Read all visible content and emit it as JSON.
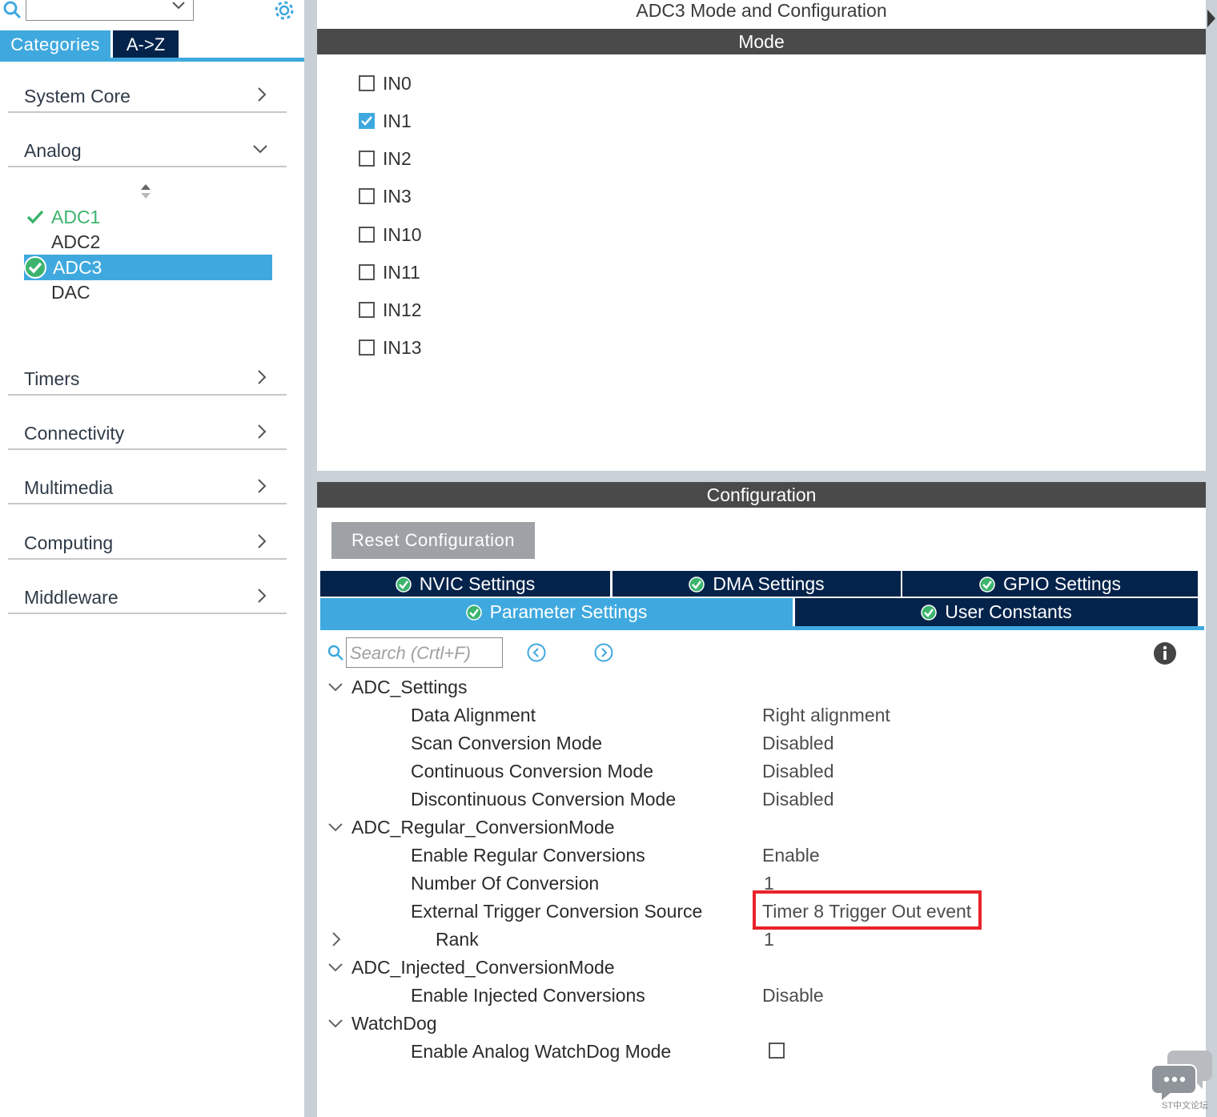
{
  "left_panel": {
    "tabs": {
      "categories": "Categories",
      "az": "A->Z"
    },
    "categories": [
      {
        "label": "System Core",
        "expanded": false
      },
      {
        "label": "Analog",
        "expanded": true
      },
      {
        "label": "Timers",
        "expanded": false
      },
      {
        "label": "Connectivity",
        "expanded": false
      },
      {
        "label": "Multimedia",
        "expanded": false
      },
      {
        "label": "Computing",
        "expanded": false
      },
      {
        "label": "Middleware",
        "expanded": false
      }
    ],
    "analog_items": [
      {
        "label": "ADC1",
        "status": "configured"
      },
      {
        "label": "ADC2",
        "status": "none"
      },
      {
        "label": "ADC3",
        "status": "selected"
      },
      {
        "label": "DAC",
        "status": "none"
      }
    ]
  },
  "main": {
    "title": "ADC3 Mode and Configuration",
    "mode_header": "Mode",
    "channels": [
      {
        "label": "IN0",
        "checked": false
      },
      {
        "label": "IN1",
        "checked": true
      },
      {
        "label": "IN2",
        "checked": false
      },
      {
        "label": "IN3",
        "checked": false
      },
      {
        "label": "IN10",
        "checked": false
      },
      {
        "label": "IN11",
        "checked": false
      },
      {
        "label": "IN12",
        "checked": false
      },
      {
        "label": "IN13",
        "checked": false
      }
    ],
    "config_header": "Configuration",
    "reset_button": "Reset Configuration",
    "settings_tabs": [
      {
        "label": "NVIC Settings"
      },
      {
        "label": "DMA Settings"
      },
      {
        "label": "GPIO Settings"
      },
      {
        "label": "Parameter Settings",
        "active": true
      },
      {
        "label": "User Constants"
      }
    ],
    "search_placeholder": "Search (Crtl+F)",
    "tree": {
      "groups": [
        "ADC_Settings",
        "ADC_Regular_ConversionMode",
        "ADC_Injected_ConversionMode",
        "WatchDog"
      ],
      "params": [
        {
          "name": "Data Alignment",
          "value": "Right alignment"
        },
        {
          "name": "Scan Conversion Mode",
          "value": "Disabled"
        },
        {
          "name": "Continuous Conversion Mode",
          "value": "Disabled"
        },
        {
          "name": "Discontinuous Conversion Mode",
          "value": "Disabled"
        },
        {
          "name": "Enable Regular Conversions",
          "value": "Enable"
        },
        {
          "name": "Number Of Conversion",
          "value": "1"
        },
        {
          "name": "External Trigger Conversion Source",
          "value": "Timer 8 Trigger Out event",
          "highlighted": true
        },
        {
          "name": "Rank",
          "value": "1"
        },
        {
          "name": "Enable Injected Conversions",
          "value": "Disable"
        },
        {
          "name": "Enable Analog WatchDog Mode",
          "value": "",
          "checkbox": false
        }
      ]
    }
  },
  "colors": {
    "accent": "#3fa9df",
    "navy": "#03234b",
    "header_bar": "#4a4a4a",
    "highlight": "#e8232a",
    "ok_green": "#3cb46e"
  },
  "watermark": {
    "text": "ST中文论坛"
  }
}
